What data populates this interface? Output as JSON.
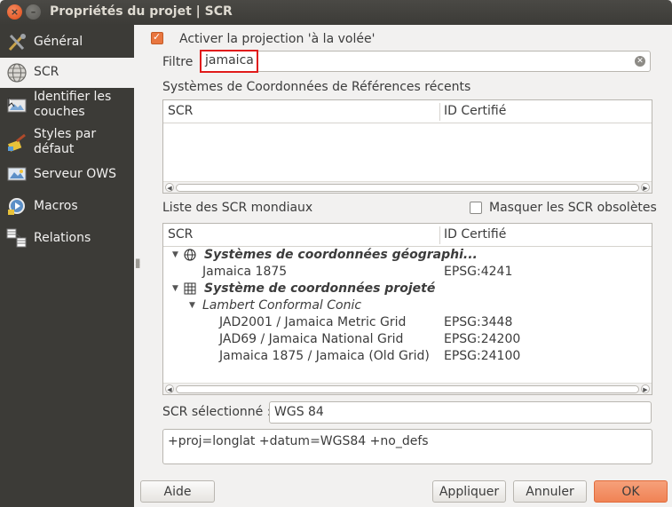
{
  "window": {
    "title": "Propriétés du projet | SCR",
    "close_glyph": "×",
    "minimize_glyph": "–"
  },
  "sidebar": {
    "items": [
      {
        "label": "Général",
        "icon": "tools-icon"
      },
      {
        "label": "SCR",
        "icon": "globe-icon"
      },
      {
        "label": "Identifier les couches",
        "icon": "identify-icon"
      },
      {
        "label": "Styles par défaut",
        "icon": "brush-icon"
      },
      {
        "label": "Serveur OWS",
        "icon": "ows-icon"
      },
      {
        "label": "Macros",
        "icon": "macro-icon"
      },
      {
        "label": "Relations",
        "icon": "relations-icon"
      }
    ],
    "active_index": 1
  },
  "main": {
    "otf_label": "Activer la projection 'à la volée'",
    "otf_checked": true,
    "filter_label": "Filtre",
    "filter_value": "jamaica",
    "recent_title": "Systèmes de Coordonnées de Références récents",
    "recent_table": {
      "headers": [
        "SCR",
        "ID Certifié"
      ],
      "rows": []
    },
    "world_title": "Liste des SCR mondiaux",
    "hide_deprecated_label": "Masquer les SCR obsolètes",
    "hide_deprecated_checked": false,
    "world_table": {
      "headers": [
        "SCR",
        "ID Certifié"
      ],
      "group_geo": "Systèmes de coordonnées géographi...",
      "row_geo_1": {
        "name": "Jamaica 1875",
        "id": "EPSG:4241"
      },
      "group_proj": "Système de coordonnées projeté",
      "subgroup_lcc": "Lambert Conformal Conic",
      "row_proj_1": {
        "name": "JAD2001 / Jamaica Metric Grid",
        "id": "EPSG:3448"
      },
      "row_proj_2": {
        "name": "JAD69 / Jamaica National Grid",
        "id": "EPSG:24200"
      },
      "row_proj_3": {
        "name": "Jamaica 1875 / Jamaica (Old Grid)",
        "id": "EPSG:24100"
      }
    },
    "selected_label": "SCR sélectionné :",
    "selected_value": "WGS 84",
    "proj_string": "+proj=longlat +datum=WGS84 +no_defs"
  },
  "buttons": {
    "help": "Aide",
    "apply": "Appliquer",
    "cancel": "Annuler",
    "ok": "OK"
  },
  "colors": {
    "accent": "#f08355",
    "sidebar_bg": "#3c3b37",
    "filter_highlight": "#e01b1b"
  }
}
